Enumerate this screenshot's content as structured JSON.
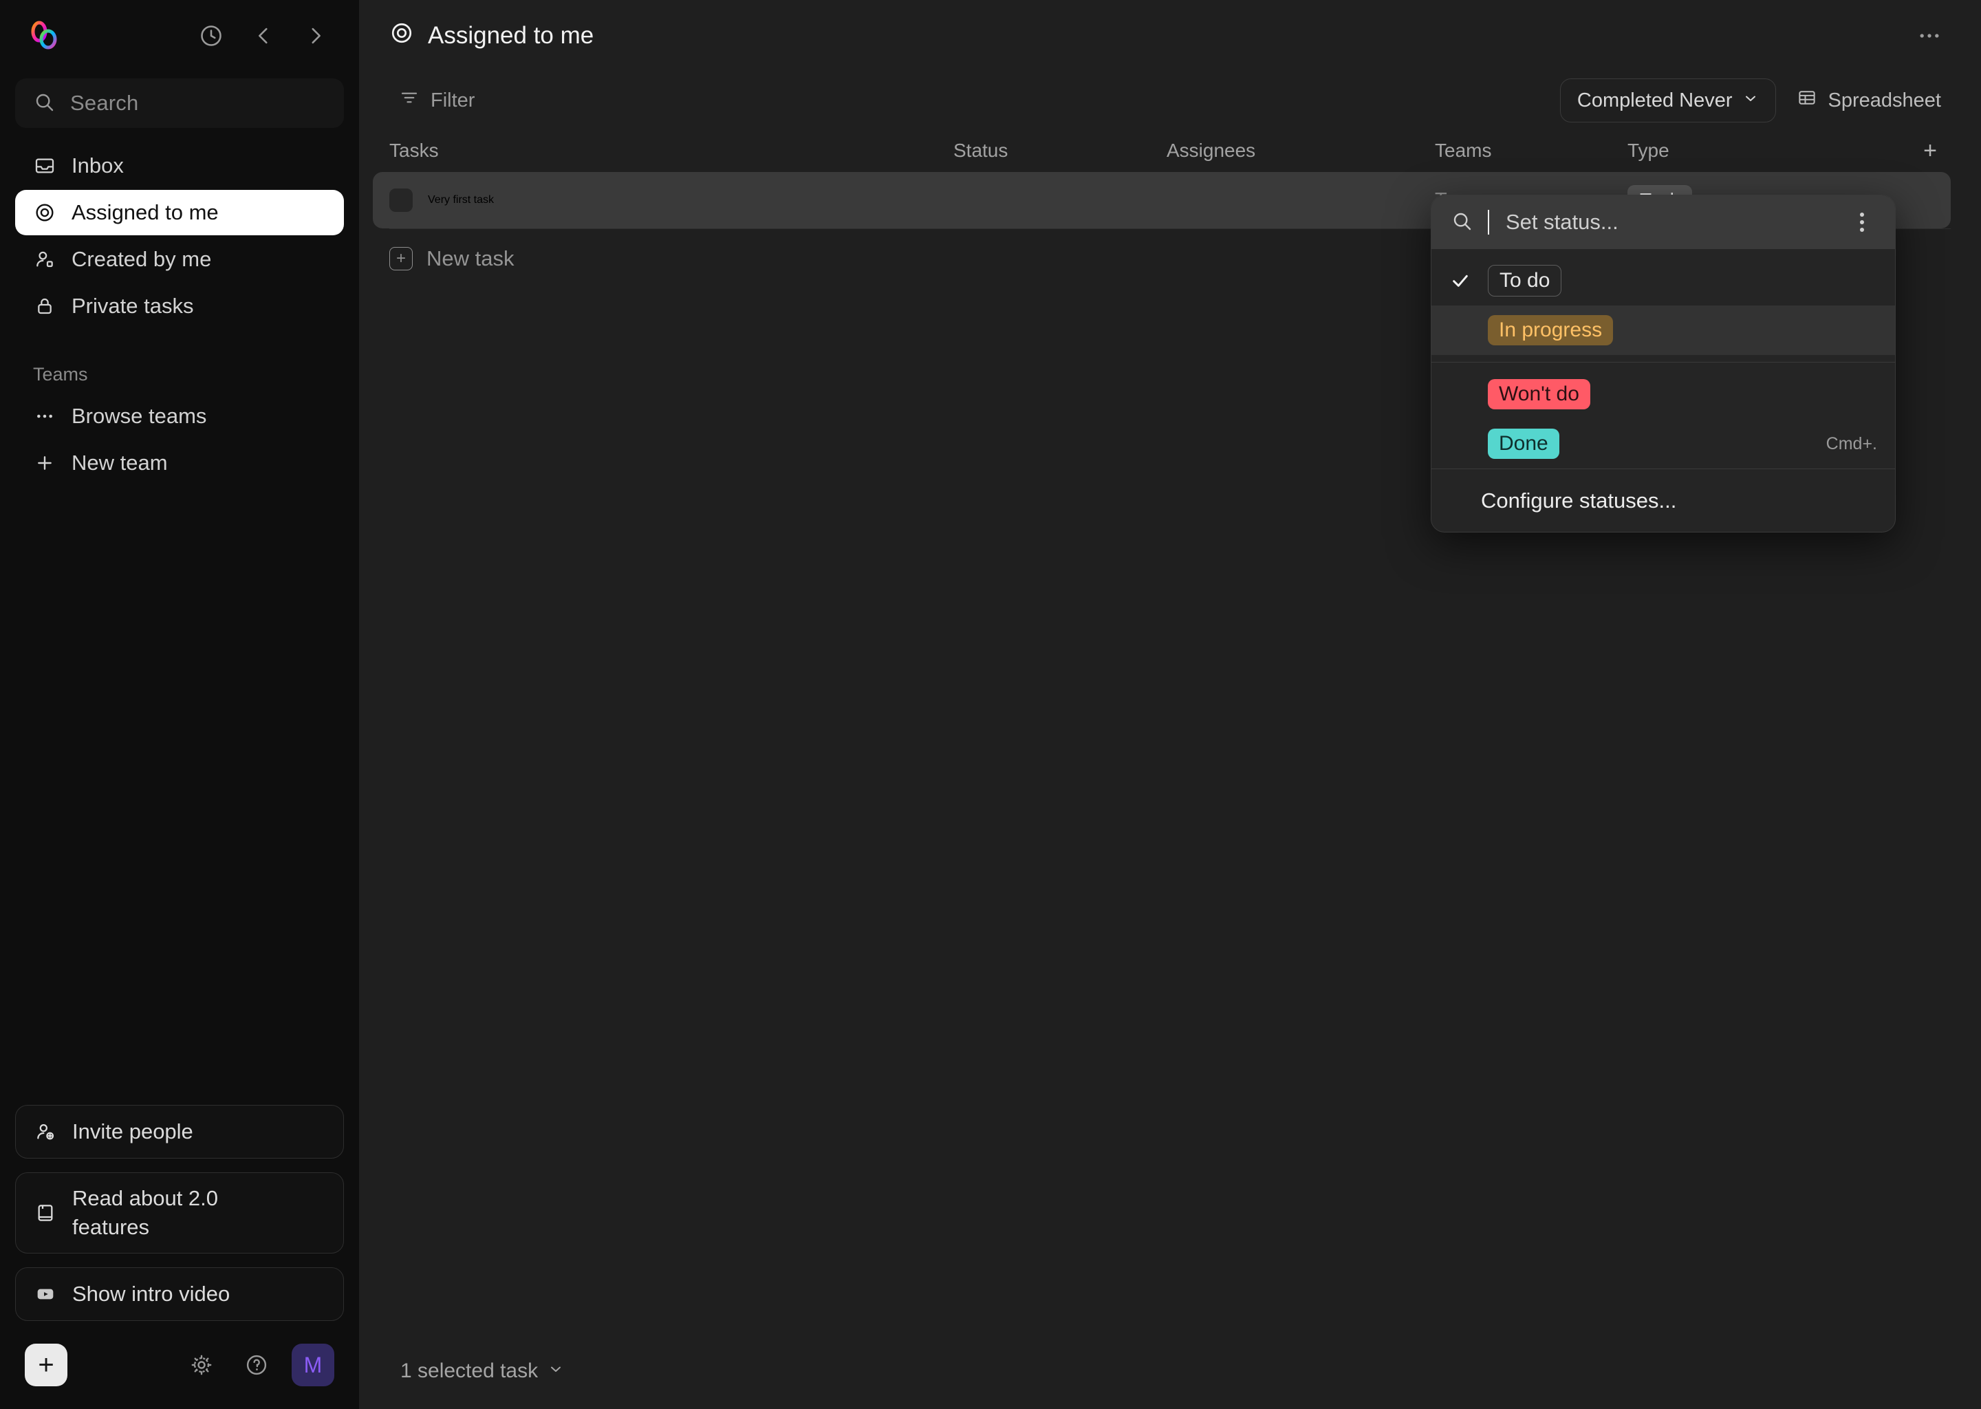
{
  "sidebar": {
    "logo_name": "app-logo",
    "top_actions": [
      {
        "name": "history-icon",
        "label": "History"
      },
      {
        "name": "chevron-left-icon",
        "label": "Back"
      },
      {
        "name": "chevron-right-icon",
        "label": "Forward"
      }
    ],
    "search": {
      "placeholder": "Search",
      "value": ""
    },
    "nav_items": [
      {
        "label": "Inbox",
        "icon": "inbox-icon",
        "active": false
      },
      {
        "label": "Assigned to me",
        "icon": "target-icon",
        "active": true
      },
      {
        "label": "Created by me",
        "icon": "user-icon",
        "active": false
      },
      {
        "label": "Private tasks",
        "icon": "lock-icon",
        "active": false
      }
    ],
    "teams_section_label": "Teams",
    "teams_items": [
      {
        "label": "Browse teams",
        "icon": "ellipsis-icon"
      },
      {
        "label": "New team",
        "icon": "plus-icon"
      }
    ],
    "bottom_buttons": [
      {
        "label": "Invite people",
        "icon": "user-plus-icon"
      },
      {
        "label": "Read about 2.0 features",
        "icon": "book-icon"
      },
      {
        "label": "Show intro video",
        "icon": "video-play-icon"
      }
    ],
    "footer": {
      "add_label": "+",
      "settings_icon": "gear-icon",
      "help_icon": "help-circle-icon",
      "avatar_initial": "M",
      "avatar_bg": "#322a63",
      "avatar_color": "#8b5cf6"
    }
  },
  "header": {
    "title": "Assigned to me",
    "title_icon": "target-icon",
    "more_label": "•••"
  },
  "toolbar": {
    "filter_label": "Filter",
    "completed_label": "Completed Never",
    "spreadsheet_label": "Spreadsheet"
  },
  "table": {
    "columns": [
      "Tasks",
      "Status",
      "Assignees",
      "Teams",
      "Type"
    ],
    "add_column_label": "+",
    "rows": [
      {
        "task": "Very first task",
        "status": "",
        "assignees": "",
        "teams_placeholder": "Teams",
        "type": "Task",
        "selected": true
      }
    ],
    "new_task_label": "New task"
  },
  "status_dropdown": {
    "search_placeholder": "Set status...",
    "search_value": "",
    "kebab_label": "More options",
    "options": [
      {
        "label": "To do",
        "style": "chip-todo",
        "checked": true,
        "highlighted": false,
        "shortcut": ""
      },
      {
        "label": "In progress",
        "style": "chip-prog",
        "checked": false,
        "highlighted": true,
        "shortcut": ""
      },
      {
        "label": "Won't do",
        "style": "chip-wont",
        "checked": false,
        "highlighted": false,
        "shortcut": ""
      },
      {
        "label": "Done",
        "style": "chip-done",
        "checked": false,
        "highlighted": false,
        "shortcut": "Cmd+."
      }
    ],
    "footer_label": "Configure statuses...",
    "colors": {
      "in_progress_bg": "#7a5e2e",
      "in_progress_text": "#ffc166",
      "wont_do_bg": "#ff5a66",
      "done_bg": "#55d6ce"
    }
  },
  "statusbar": {
    "selection_label": "1 selected task"
  }
}
